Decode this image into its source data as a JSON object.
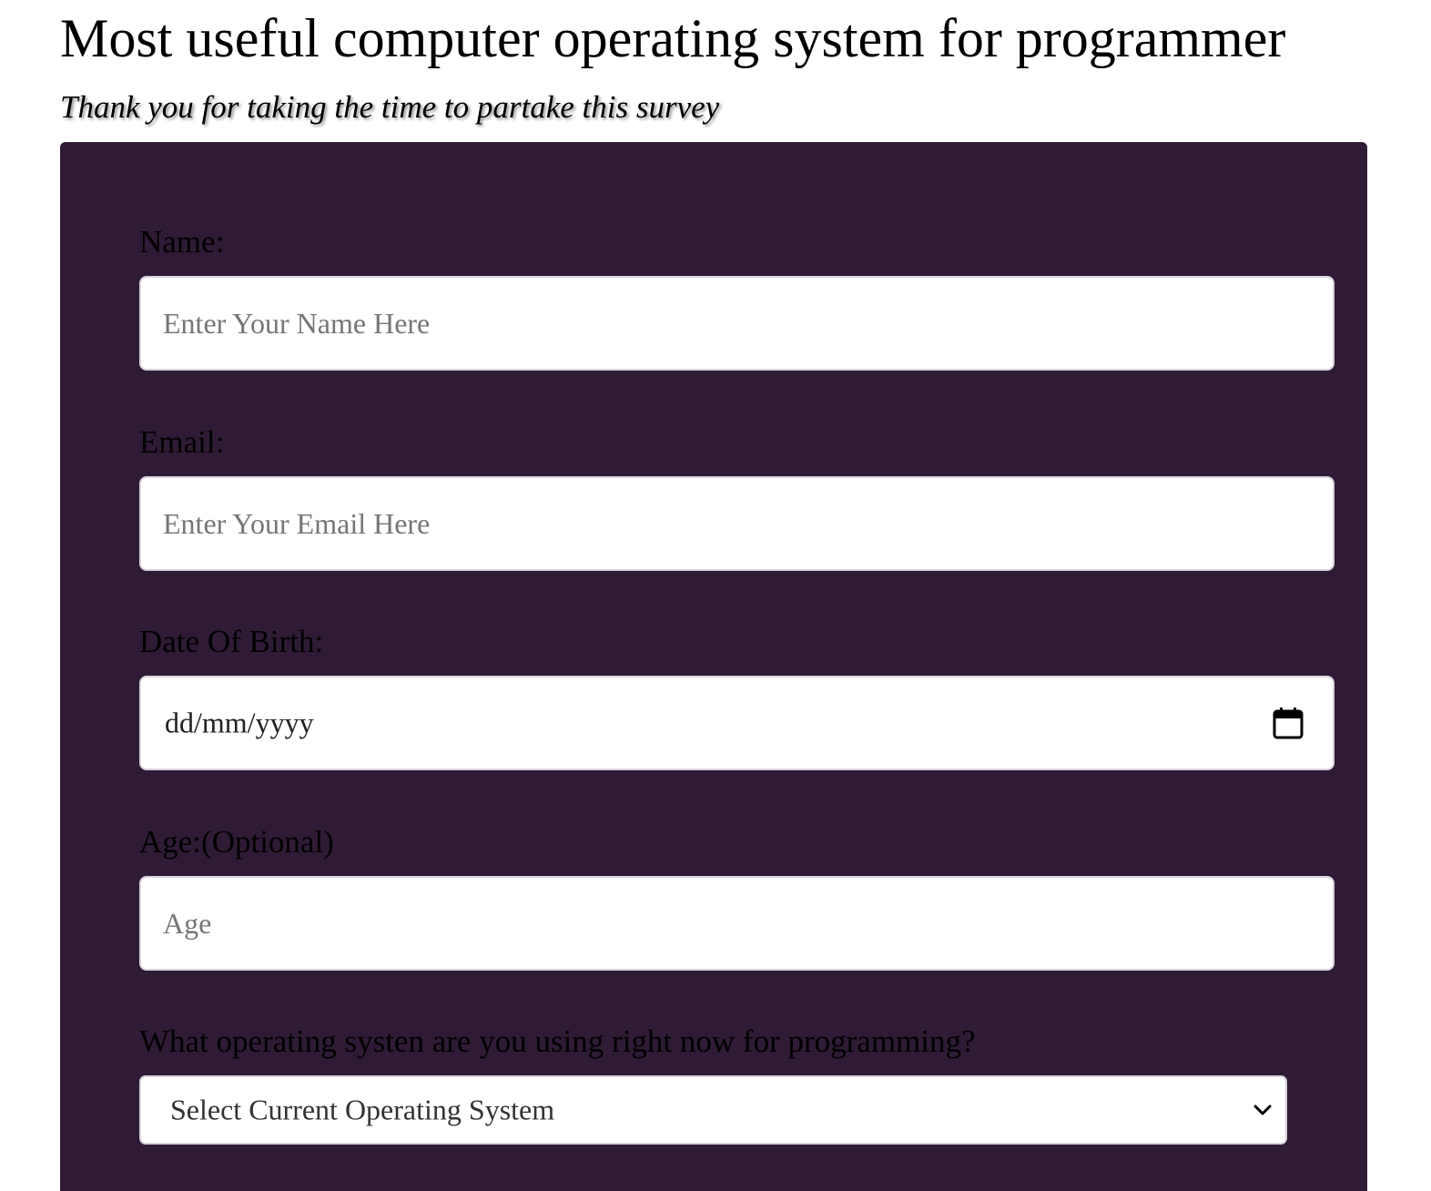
{
  "header": {
    "title": "Most useful computer operating system for programmer",
    "subtitle": "Thank you for taking the time to partake this survey"
  },
  "form": {
    "name": {
      "label": "Name:",
      "placeholder": "Enter Your Name Here",
      "value": ""
    },
    "email": {
      "label": "Email:",
      "placeholder": "Enter Your Email Here",
      "value": ""
    },
    "dob": {
      "label": "Date Of Birth:",
      "placeholder": "dd/mm/yyyy",
      "icon": "calendar-icon"
    },
    "age": {
      "label": "Age:(Optional)",
      "placeholder": "Age",
      "value": ""
    },
    "os": {
      "label": "What operating systen are you using right now for programming?",
      "selected": "Select Current Operating System",
      "icon": "chevron-down-icon"
    }
  },
  "colors": {
    "panel_background": "#2f1b35",
    "input_background": "#ffffff",
    "input_border": "#d6d3dc",
    "placeholder": "#767676"
  }
}
